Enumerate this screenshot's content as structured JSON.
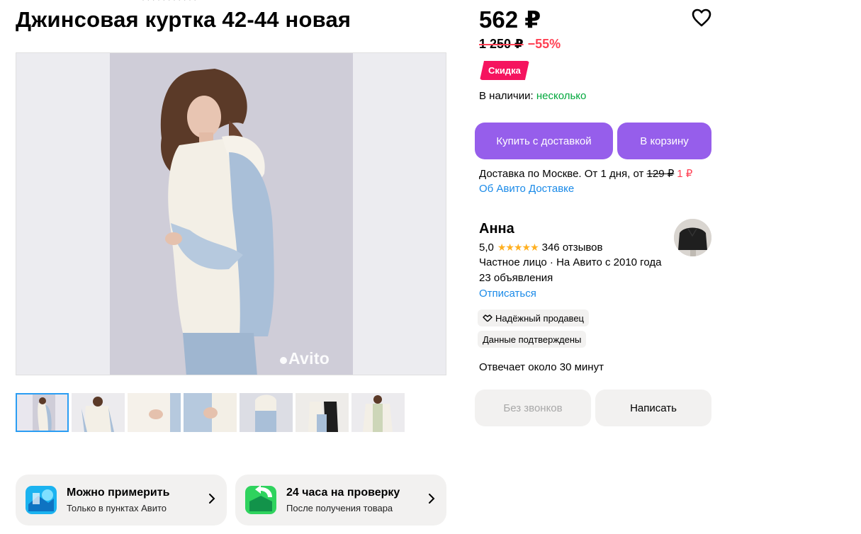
{
  "breadcrumb": "· · · · · · · · · · ·",
  "listing": {
    "title": "Джинсовая куртка 42-44 новая"
  },
  "gallery": {
    "watermark": "Avito",
    "thumbnail_count": 7,
    "active_index": 0
  },
  "promos": [
    {
      "title": "Можно примерить",
      "subtitle": "Только в пунктах Авито"
    },
    {
      "title": "24 часа на проверку",
      "subtitle": "После получения товара"
    }
  ],
  "price": {
    "current": "562 ₽",
    "old": "1 250 ₽",
    "discount": "−55%",
    "badge": "Скидка"
  },
  "stock": {
    "label": "В наличии:",
    "value": "несколько"
  },
  "actions": {
    "buy_label": "Купить с доставкой",
    "cart_label": "В корзину"
  },
  "delivery": {
    "text": "Доставка по Москве. От 1 дня, от",
    "old_price": "129 ₽",
    "new_price": "1 ₽",
    "link": "Об Авито Доставке"
  },
  "seller": {
    "name": "Анна",
    "rating": "5,0",
    "stars": "★★★★★",
    "reviews": "346 отзывов",
    "type_since": "Частное лицо · На Авито с 2010 года",
    "listings": "23 объявления",
    "unsubscribe": "Отписаться",
    "badge_reliable": "Надёжный продавец",
    "badge_verified": "Данные подтверждены",
    "response": "Отвечает около 30 минут"
  },
  "contact": {
    "no_calls_label": "Без звонков",
    "write_label": "Написать"
  },
  "colors": {
    "accent_purple": "#965eeb",
    "sale_pink": "#f5145f",
    "discount_red": "#ff4053",
    "stock_green": "#02a83d",
    "link_blue": "#1a8ae8"
  }
}
